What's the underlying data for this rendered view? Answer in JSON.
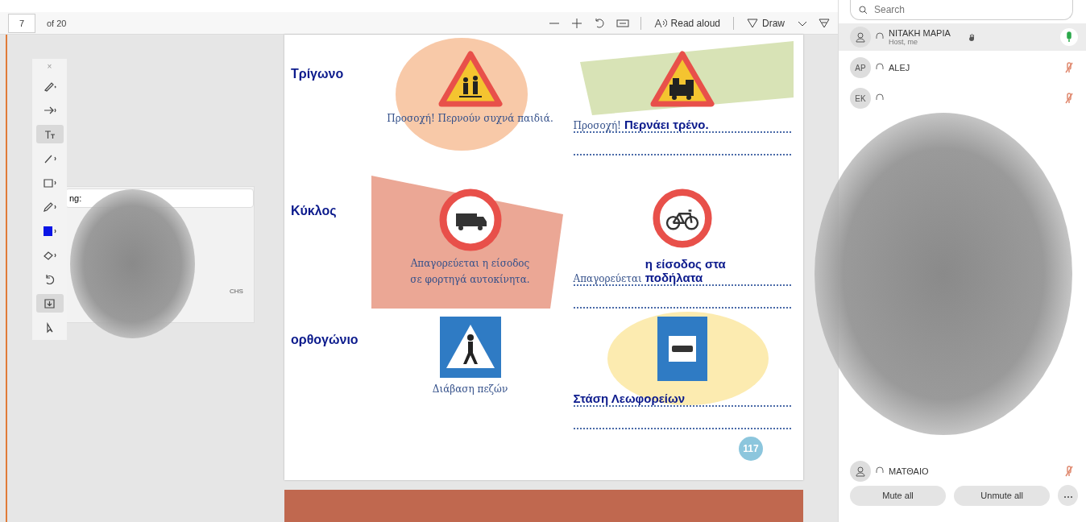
{
  "toolbar": {
    "page": "7",
    "page_count": "of 20",
    "read_aloud": "Read aloud",
    "draw": "Draw"
  },
  "draw_close": "×",
  "draw_tools": [
    {
      "kind": "highlighter",
      "selected": false
    },
    {
      "kind": "arrow",
      "selected": false
    },
    {
      "kind": "text",
      "selected": true
    },
    {
      "kind": "line",
      "selected": false
    },
    {
      "kind": "rectangle",
      "selected": false
    },
    {
      "kind": "pen",
      "selected": false
    },
    {
      "kind": "color",
      "selected": false,
      "color": "#0a14e6"
    },
    {
      "kind": "eraser",
      "selected": false
    },
    {
      "kind": "undo",
      "selected": false
    },
    {
      "kind": "save",
      "selected": true
    },
    {
      "kind": "select",
      "selected": false
    }
  ],
  "speaking_panel": {
    "label": "ng:",
    "name_right": "CHS"
  },
  "page": {
    "rows": [
      {
        "shape_label": "Τρίγωνο",
        "left": {
          "kind": "children",
          "caption_lines": [
            "Προσοχή! Περνούν συχνά παιδιά."
          ]
        },
        "right": {
          "kind": "train",
          "prompt": "Προσοχή!",
          "answer_lines": [
            "Περνάει τρένο."
          ]
        }
      },
      {
        "shape_label": "Κύκλος",
        "left": {
          "kind": "truck",
          "caption_lines": [
            "Απαγορεύεται η είσοδος",
            "σε φορτηγά αυτοκίνητα."
          ]
        },
        "right": {
          "kind": "bicycle",
          "prompt": "Απαγορεύεται",
          "answer_lines": [
            "η είσοδος στα",
            "ποδήλατα"
          ]
        }
      },
      {
        "shape_label": "ορθογώνιο",
        "left": {
          "kind": "pedestrian",
          "caption_lines": [
            "Διάβαση πεζών"
          ]
        },
        "right": {
          "kind": "bus",
          "answer_lines": [
            "Στάση Λεωφορείων"
          ]
        }
      }
    ],
    "page_number": "117"
  },
  "participants": {
    "search_placeholder": "Search",
    "people": [
      {
        "name": "NITAKH MAPIA",
        "role": "Host, me",
        "mic_on": true,
        "hand_raised": true,
        "highlighted": true
      },
      {
        "initials": "AP",
        "name": "ALEJ",
        "mic_on": false,
        "hand_raised": false,
        "highlighted": false
      },
      {
        "initials": "EK",
        "mic_on": false,
        "hand_raised": false,
        "highlighted": false
      }
    ],
    "bottom_people": [
      {
        "name": "ΜΑΤΘΑΙΟ",
        "mic_on": false,
        "hand_raised": false,
        "highlighted": false
      }
    ],
    "buttons": [
      "Mute all",
      "Unmute all"
    ]
  }
}
